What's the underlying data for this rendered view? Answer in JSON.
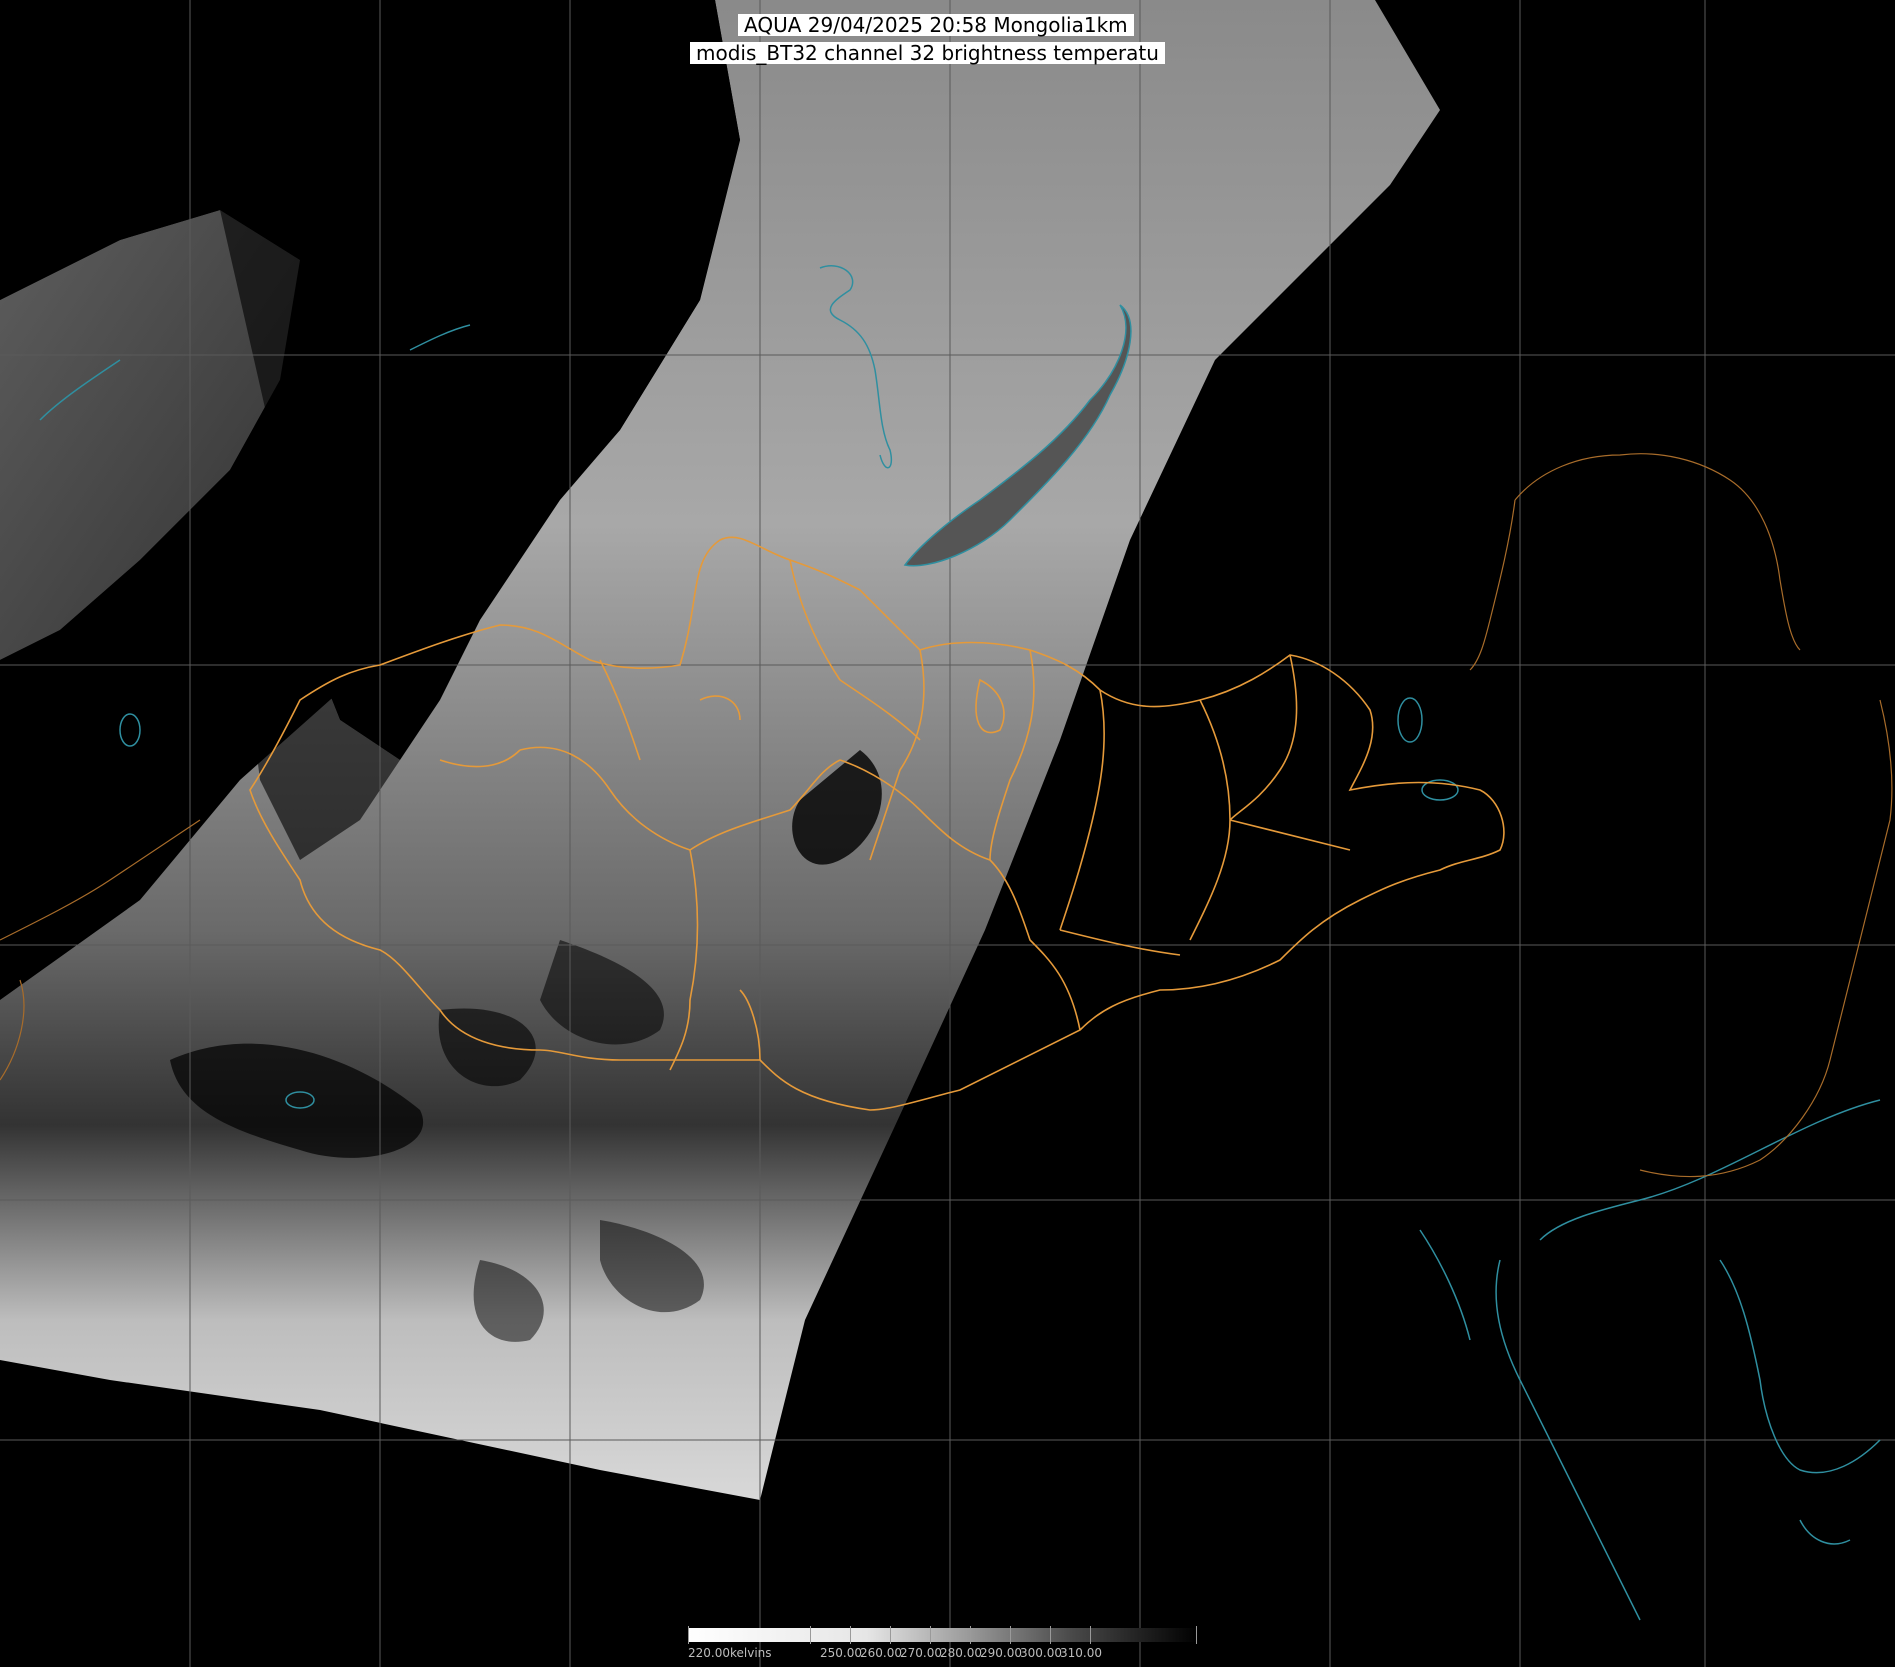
{
  "title": {
    "line1": "AQUA 29/04/2025 20:58 Mongolia1km",
    "line2": "modis_BT32 channel 32 brightness temperatu"
  },
  "legend": {
    "first_label": "220.00kelvins",
    "labels": [
      "250.00",
      "260.00",
      "270.00",
      "280.00",
      "290.00",
      "300.00",
      "310.00"
    ],
    "gradient_colors": [
      "#ffffff",
      "#000000"
    ]
  },
  "colors": {
    "background": "#000000",
    "graticule": "#5a5a5a",
    "admin_borders": "#e59a3a",
    "coastlines_lakes": "#2f8fa0",
    "international_border": "#a86c2a",
    "swath_north": "#9a9a9a",
    "swath_south": "#c8c8c8"
  }
}
